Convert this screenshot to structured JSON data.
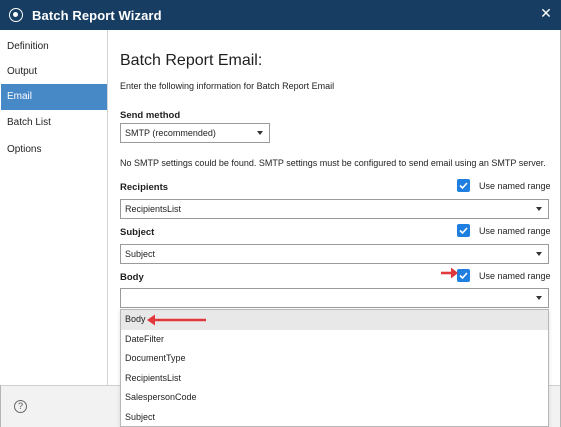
{
  "window": {
    "title": "Batch Report Wizard",
    "close_icon": "close-icon"
  },
  "sidebar": {
    "items": [
      {
        "label": "Definition",
        "active": false
      },
      {
        "label": "Output",
        "active": false
      },
      {
        "label": "Email",
        "active": true
      },
      {
        "label": "Batch List",
        "active": false
      },
      {
        "label": "Options",
        "active": false
      }
    ]
  },
  "main": {
    "heading": "Batch Report Email:",
    "intro": "Enter the following information for Batch Report Email",
    "send_method": {
      "label": "Send method",
      "value": "SMTP (recommended)"
    },
    "note": "No SMTP settings could be found. SMTP settings must be configured to send email using an SMTP server.",
    "recipients": {
      "label": "Recipients",
      "value": "RecipientsList",
      "checkbox_label": "Use named range",
      "checked": true
    },
    "subject": {
      "label": "Subject",
      "value": "Subject",
      "checkbox_label": "Use named range",
      "checked": true
    },
    "body": {
      "label": "Body",
      "value": "",
      "checkbox_label": "Use named range",
      "checked": true
    },
    "dropdown_options": [
      "Body",
      "DateFilter",
      "DocumentType",
      "RecipientsList",
      "SalespersonCode",
      "Subject"
    ]
  },
  "footer": {
    "help_icon": "help-icon"
  },
  "colors": {
    "titlebar": "#173d63",
    "nav_active": "#4788c7",
    "checkbox": "#1f7fe0",
    "annotation_arrow": "#e0383b"
  }
}
